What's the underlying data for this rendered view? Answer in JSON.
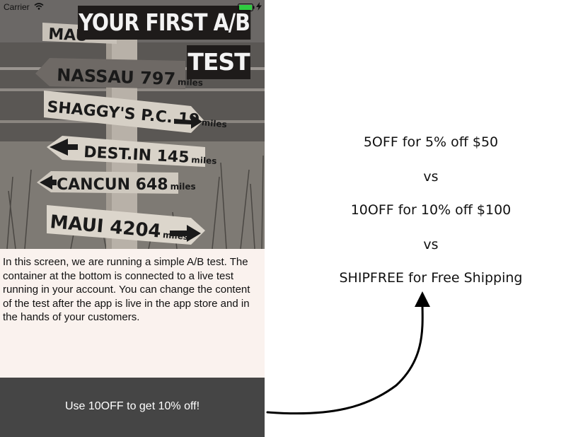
{
  "status_bar": {
    "carrier": "Carrier",
    "battery_color": "#2ecc40"
  },
  "hero": {
    "title_line1": "YOUR FIRST A/B",
    "title_line2": "TEST",
    "signs": [
      {
        "text": "MAU",
        "sub": ""
      },
      {
        "text": "NASSAU 797",
        "sub": "miles"
      },
      {
        "text": "SHAGGY'S P.C. 19",
        "sub": "miles"
      },
      {
        "text": "DEST.IN 145",
        "sub": "miles"
      },
      {
        "text": "CANCUN 648",
        "sub": "miles"
      },
      {
        "text": "MAUI 4204",
        "sub": "miles"
      }
    ]
  },
  "description": "In this screen, we are running a simple A/B test. The container at the bottom is connected to a live test running in your account.  You can change the content of the test after the app is live in the app store and in the hands of your customers.",
  "footer": {
    "text": "Use 10OFF to get 10% off!",
    "background": "#454545"
  },
  "variants": {
    "v1": "5OFF for 5% off $50",
    "vs1": "vs",
    "v2": "10OFF for 10% off $100",
    "vs2": "vs",
    "v3": "SHIPFREE for Free Shipping"
  },
  "icons": [
    "wifi-icon",
    "battery-icon",
    "charge-icon",
    "arrow-icon"
  ]
}
